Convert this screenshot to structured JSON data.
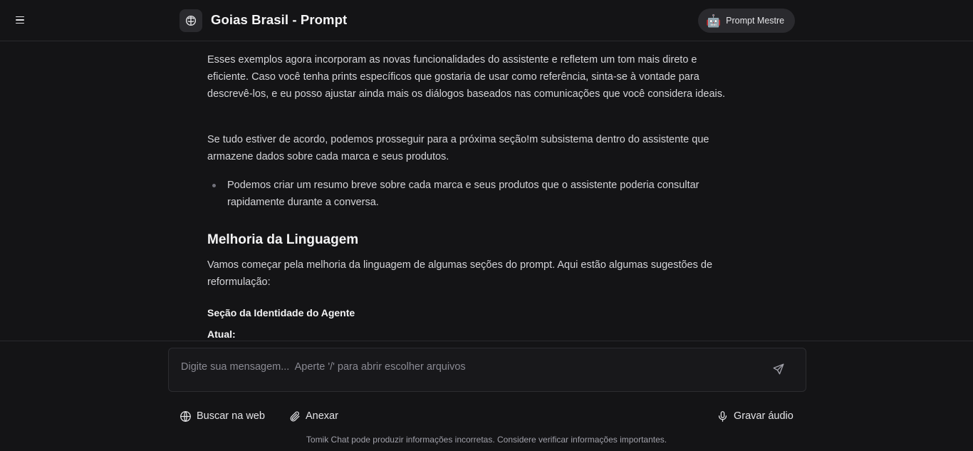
{
  "header": {
    "title": "Goias Brasil - Prompt",
    "menu_icon": "hamburger-menu-icon",
    "logo_icon": "brain-icon",
    "agent": {
      "emoji": "🤖",
      "label": "Prompt Mestre"
    }
  },
  "message": {
    "paragraph_1": "Esses exemplos agora incorporam as novas funcionalidades do assistente e refletem um tom mais direto e eficiente. Caso você tenha prints específicos que gostaria de usar como referência, sinta-se à vontade para descrevê-los, e eu posso ajustar ainda mais os diálogos baseados nas comunicações que você considera ideais.",
    "paragraph_2": "Se tudo estiver de acordo, podemos prosseguir para a próxima seção!m subsistema dentro do assistente que armazene dados sobre cada marca e seus produtos.",
    "bullet_1": "Podemos criar um resumo breve sobre cada marca e seus produtos que o assistente poderia consultar rapidamente durante a conversa.",
    "heading": "Melhoria da Linguagem",
    "paragraph_3": "Vamos começar pela melhoria da linguagem de algumas seções do prompt. Aqui estão algumas sugestões de reformulação:",
    "strong_1": "Seção da Identidade do Agente",
    "strong_2": "Atual:"
  },
  "composer": {
    "placeholder": "Digite sua mensagem...  Aperte '/' para abrir escolher arquivos",
    "value": "",
    "send_icon": "send-icon"
  },
  "tools": {
    "web_search": "Buscar na web",
    "attach": "Anexar",
    "record_audio": "Gravar áudio"
  },
  "disclaimer": "Tomik Chat pode produzir informações incorretas. Considere verificar informações importantes."
}
